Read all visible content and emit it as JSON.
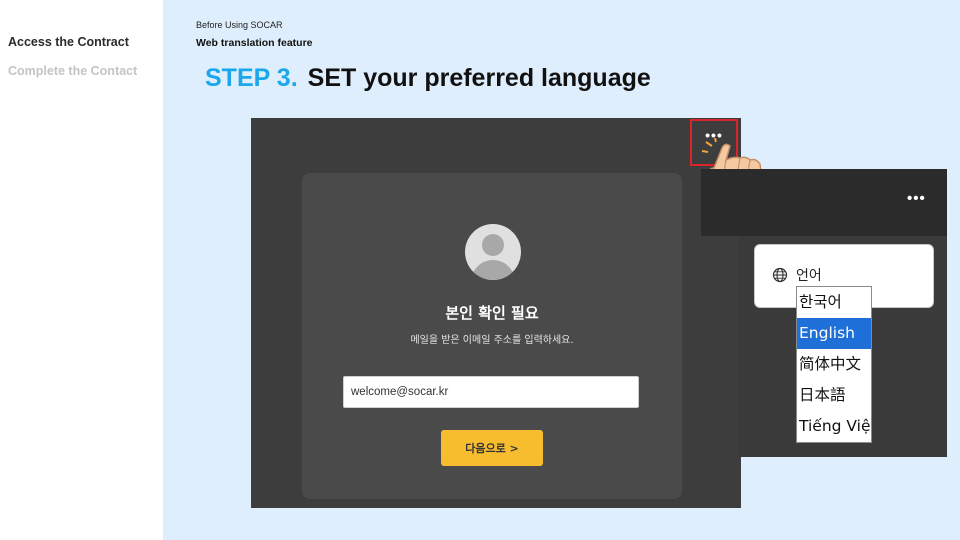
{
  "sidebar": {
    "items": [
      {
        "label": "Access the Contract",
        "active": true
      },
      {
        "label": "Complete the Contact",
        "active": false
      }
    ]
  },
  "breadcrumb": {
    "top": "Before Using SOCAR",
    "bottom": "Web translation feature"
  },
  "heading": {
    "step": "STEP 3.",
    "title": "SET your preferred language"
  },
  "login_screen": {
    "menu_icon": "more-dots-icon",
    "title": "본인 확인 필요",
    "subtitle": "메일을 받은 이메일 주소를 입력하세요.",
    "email_value": "welcome@socar.kr",
    "next_label": "다음으로 >"
  },
  "language_panel": {
    "menu_icon": "more-dots-icon",
    "label": "언어",
    "options": [
      "한국어",
      "English",
      "简体中文",
      "日本語",
      "Tiếng Việt"
    ],
    "selected": "English"
  },
  "colors": {
    "accent": "#1aa7ec",
    "highlight_border": "#d9252a",
    "button": "#f7bd2f",
    "selected_option": "#1f6fd8"
  }
}
